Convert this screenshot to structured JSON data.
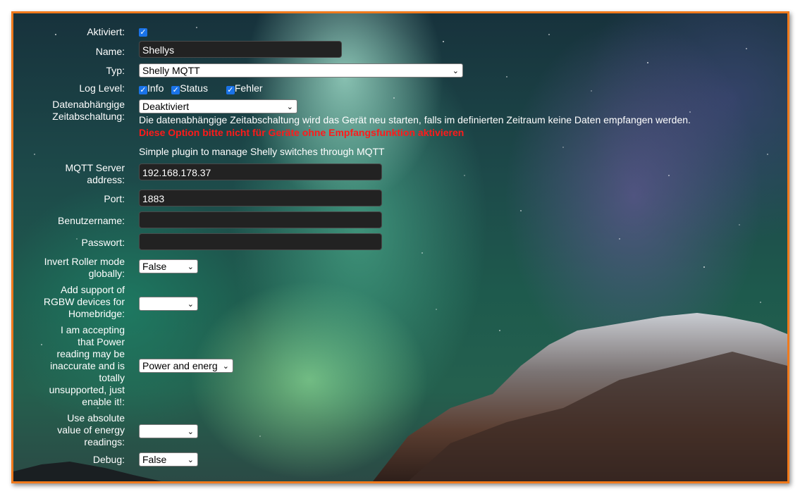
{
  "fields": {
    "aktiviert": {
      "label": "Aktiviert:",
      "checked": "✓"
    },
    "name": {
      "label": "Name:",
      "value": "Shellys"
    },
    "typ": {
      "label": "Typ:",
      "value": "Shelly MQTT"
    },
    "log_level": {
      "label": "Log Level:",
      "options": [
        {
          "label": "Info",
          "checked": "✓"
        },
        {
          "label": "Status",
          "checked": "✓"
        },
        {
          "label": "Fehler",
          "checked": "✓"
        }
      ]
    },
    "timeout": {
      "label_line1": "Datenabhängige",
      "label_line2": "Zeitabschaltung:",
      "value": "Deaktiviert",
      "description": "Die datenabhängige Zeitabschaltung wird das Gerät neu starten, falls im definierten Zeitraum keine Daten empfangen werden.",
      "warning": "Diese Option bitte nicht für Geräte ohne Empfangsfunktion aktivieren"
    },
    "plugin_description": "Simple plugin to manage Shelly switches through MQTT",
    "mqtt_server": {
      "label_line1": "MQTT Server",
      "label_line2": "address:",
      "value": "192.168.178.37"
    },
    "port": {
      "label": "Port:",
      "value": "1883"
    },
    "benutzername": {
      "label": "Benutzername:",
      "value": ""
    },
    "passwort": {
      "label": "Passwort:",
      "value": ""
    },
    "invert_roller": {
      "label_line1": "Invert Roller mode",
      "label_line2": "globally:",
      "value": "False"
    },
    "rgbw": {
      "label_line1": "Add support of",
      "label_line2": "RGBW devices for",
      "label_line3": "Homebridge:",
      "value": ""
    },
    "power_reading": {
      "label_lines": [
        "I am accepting",
        "that Power",
        "reading may be",
        "inaccurate and is",
        "totally",
        "unsupported, just",
        "enable it!:"
      ],
      "value": "Power and energy"
    },
    "absolute_energy": {
      "label_line1": "Use absolute",
      "label_line2": "value of energy",
      "label_line3": "readings:",
      "value": ""
    },
    "debug": {
      "label": "Debug:",
      "value": "False"
    }
  },
  "icons": {
    "chevron": "chevron-down-icon",
    "check": "checkmark-icon"
  },
  "colors": {
    "border": "#f07a1c",
    "warning": "#ff1a1a",
    "checkbox": "#1a73e8",
    "input_bg": "#222222"
  }
}
